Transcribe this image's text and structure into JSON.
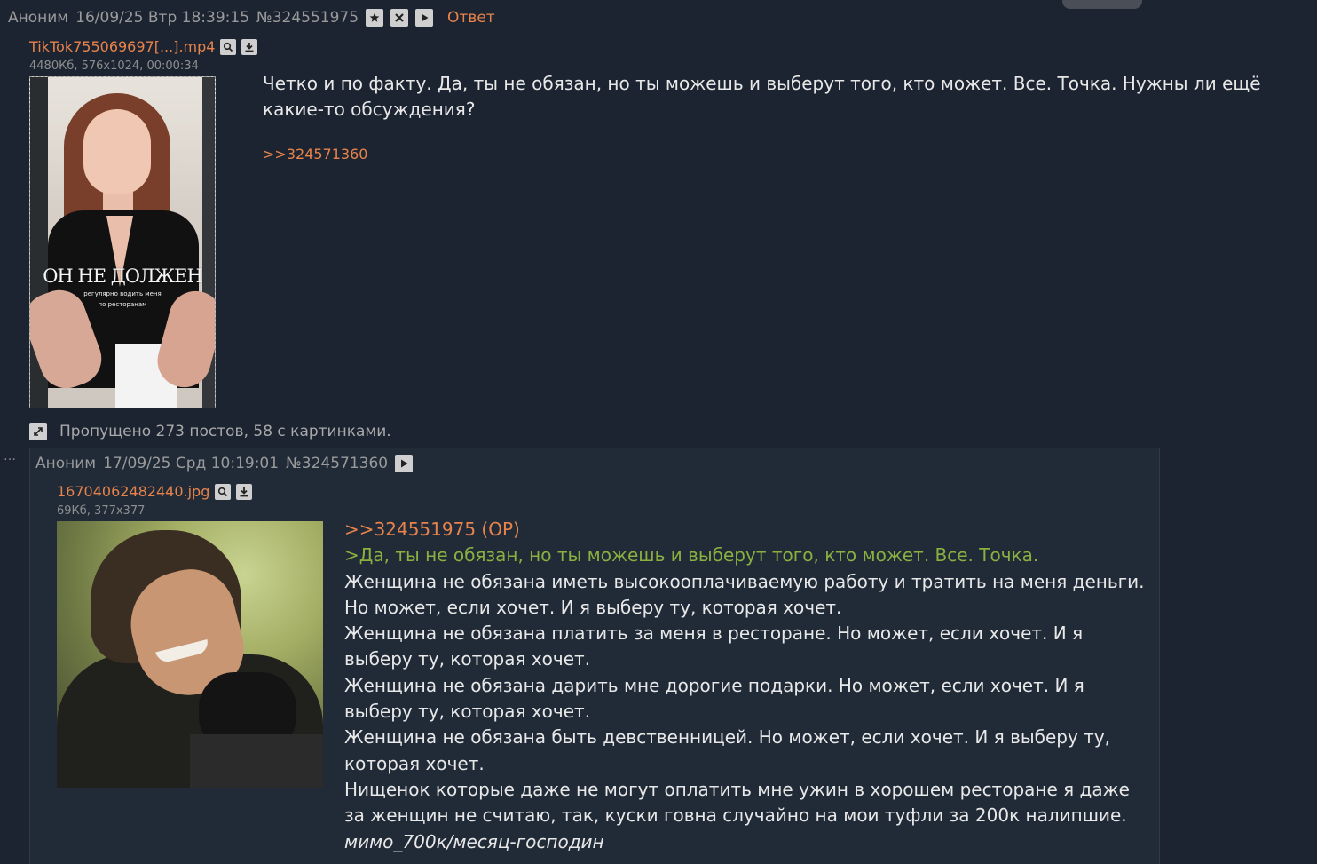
{
  "op": {
    "author": "Аноним",
    "date": "16/09/25 Втр 18:39:15",
    "post_number": "№324551975",
    "reply_label": "Ответ",
    "file": {
      "name": "TikTok755069697[...].mp4",
      "meta": "4480Кб, 576x1024, 00:00:34",
      "overlay_title": "ОН НЕ ДОЛЖЕН",
      "overlay_sub_1": "регулярно водить меня",
      "overlay_sub_2": "по ресторанам"
    },
    "text": "Четко и по факту. Да, ты не обязан, но ты можешь и выберут того, кто может. Все. Точка. Нужны ли ещё какие-то обсуждения?",
    "backlink": ">>324571360"
  },
  "omitted": {
    "text": "Пропущено 273 постов, 58 с картинками."
  },
  "reply": {
    "author": "Аноним",
    "date": "17/09/25 Срд 10:19:01",
    "post_number": "№324571360",
    "file": {
      "name": "16704062482440.jpg",
      "meta": "69Кб, 377x377"
    },
    "quote_link": ">>324551975 (OP)",
    "greentext": ">Да, ты не обязан, но ты можешь и выберут того, кто может. Все. Точка.",
    "lines": [
      "Женщина не обязана иметь высокооплачиваемую работу и тратить на меня деньги. Но может, если хочет. И я выберу ту, которая хочет.",
      "Женщина не обязана платить за меня в ресторане. Но может, если хочет. И я выберу ту, которая хочет.",
      "Женщина не обязана дарить мне дорогие подарки. Но может, если хочет. И я выберу ту, которая хочет.",
      "Женщина не обязана быть девственницей. Но может, если хочет. И я выберу ту, которая хочет.",
      "Нищенок которые даже не могут оплатить мне ужин в хорошем ресторане я даже за женщин не считаю, так, куски говна случайно на мои туфли за 200к налипшие."
    ],
    "signature": "мимо_700к/месяц-господин"
  },
  "colors": {
    "background": "#1c2431",
    "link": "#e8834b",
    "greentext": "#8ab03f",
    "reply_box": "#212b38"
  }
}
